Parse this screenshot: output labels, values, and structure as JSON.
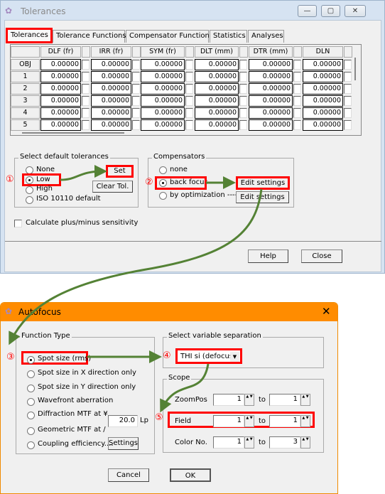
{
  "tolerances_window": {
    "title": "Tolerances",
    "window_buttons": {
      "minimize": "—",
      "maximize": "▢",
      "close": "✕"
    },
    "tabs": [
      {
        "label": "Tolerances",
        "active": true
      },
      {
        "label": "Tolerance Functions"
      },
      {
        "label": "Compensator Functions"
      },
      {
        "label": "Statistics"
      },
      {
        "label": "Analyses"
      }
    ],
    "table": {
      "columns": [
        "DLF (fr)",
        "IRR (fr)",
        "SYM (fr)",
        "DLT (mm)",
        "DTR (mm)",
        "DLN"
      ],
      "rows": [
        {
          "label": "OBJ",
          "values": [
            "0.00000",
            "0.00000",
            "0.00000",
            "0.00000",
            "0.00000",
            "0.00000"
          ]
        },
        {
          "label": "1",
          "values": [
            "0.00000",
            "0.00000",
            "0.00000",
            "0.00000",
            "0.00000",
            "0.00000"
          ]
        },
        {
          "label": "2",
          "values": [
            "0.00000",
            "0.00000",
            "0.00000",
            "0.00000",
            "0.00000",
            "0.00000"
          ]
        },
        {
          "label": "3",
          "values": [
            "0.00000",
            "0.00000",
            "0.00000",
            "0.00000",
            "0.00000",
            "0.00000"
          ]
        },
        {
          "label": "4",
          "values": [
            "0.00000",
            "0.00000",
            "0.00000",
            "0.00000",
            "0.00000",
            "0.00000"
          ]
        },
        {
          "label": "5",
          "values": [
            "0.00000",
            "0.00000",
            "0.00000",
            "0.00000",
            "0.00000",
            "0.00000"
          ]
        }
      ]
    },
    "default_tolerances": {
      "title": "Select default tolerances",
      "options": [
        "None",
        "Low",
        "High",
        "ISO 10110 default"
      ],
      "selected": "Low",
      "set": "Set",
      "clear": "Clear Tol."
    },
    "compensators": {
      "title": "Compensators",
      "options": [
        "none",
        "back focus",
        "by optimization ---->"
      ],
      "selected": "back focus",
      "edit1": "Edit settings",
      "edit2": "Edit settings"
    },
    "sensitivity_checkbox": "Calculate plus/minus sensitivity",
    "help": "Help",
    "close": "Close"
  },
  "autofocus_window": {
    "title": "Autofocus",
    "close": "✕",
    "function_type": {
      "title": "Function Type",
      "options": [
        "Spot size (rms)",
        "Spot size in X direction only",
        "Spot size in Y direction only",
        "Wavefront aberration",
        "Diffraction MTF at ¥",
        "Geometric MTF at  /",
        "Coupling efficiency...."
      ],
      "selected": "Spot size (rms)",
      "mtf_value": "20.0",
      "mtf_unit": "Lp",
      "settings": "Settings"
    },
    "variable_separation": {
      "title": "Select variable separation",
      "value": "THI si (defocus)"
    },
    "scope": {
      "title": "Scope",
      "to": "to",
      "rows": [
        {
          "label": "ZoomPos",
          "from": "1",
          "to": "1"
        },
        {
          "label": "Field",
          "from": "1",
          "to": "1"
        },
        {
          "label": "Color No.",
          "from": "1",
          "to": "3"
        }
      ]
    },
    "cancel": "Cancel",
    "ok": "OK"
  },
  "annotations": [
    "①",
    "②",
    "③",
    "④",
    "⑤"
  ],
  "colors": {
    "highlight": "#ff0000",
    "arrow": "#548235",
    "title_orange": "#ff8c00"
  }
}
